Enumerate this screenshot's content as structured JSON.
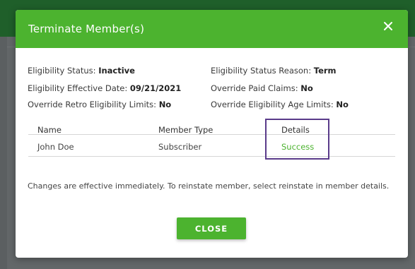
{
  "modal": {
    "title": "Terminate Member(s)",
    "close_icon": "close-icon",
    "colors": {
      "accent": "#4cb32f",
      "highlight": "#5a3b8a"
    }
  },
  "info": {
    "eligibility_status_label": "Eligibility Status:",
    "eligibility_status_value": "Inactive",
    "eligibility_status_reason_label": "Eligibility Status Reason:",
    "eligibility_status_reason_value": "Term",
    "effective_date_label": "Eligibility Effective Date:",
    "effective_date_value": "09/21/2021",
    "override_paid_claims_label": "Override Paid Claims:",
    "override_paid_claims_value": "No",
    "override_retro_label": "Override Retro Eligibility Limits:",
    "override_retro_value": "No",
    "override_age_label": "Override Eligibility Age Limits:",
    "override_age_value": "No"
  },
  "table": {
    "columns": [
      "Name",
      "Member Type",
      "Details"
    ],
    "rows": [
      {
        "name": "John Doe",
        "member_type": "Subscriber",
        "details": "Success"
      }
    ]
  },
  "note": "Changes are effective immediately. To reinstate member, select reinstate in member details.",
  "buttons": {
    "close_label": "CLOSE"
  }
}
